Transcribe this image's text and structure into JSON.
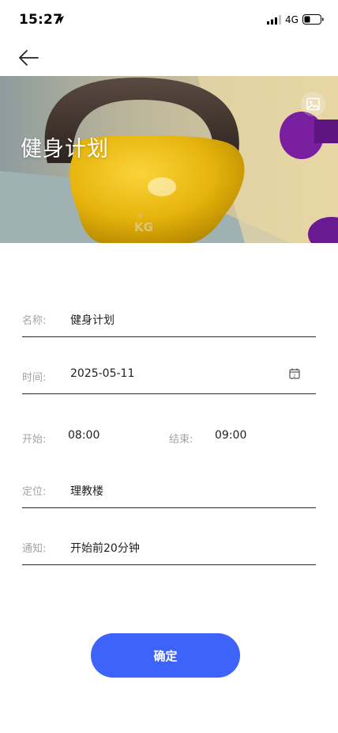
{
  "status_bar": {
    "time": "15:27",
    "network": "4G"
  },
  "hero": {
    "title": "健身计划"
  },
  "form": {
    "name_label": "名称:",
    "name_value": "健身计划",
    "date_label": "时间:",
    "date_value": "2025-05-11",
    "start_label": "开始:",
    "start_value": "08:00",
    "end_label": "结束:",
    "end_value": "09:00",
    "location_label": "定位:",
    "location_value": "理教楼",
    "notify_label": "通知:",
    "notify_value": "开始前20分钟"
  },
  "confirm_label": "确定",
  "colors": {
    "accent": "#3d63fb",
    "label": "#a3a3a3",
    "divider": "#2b2b2b"
  }
}
